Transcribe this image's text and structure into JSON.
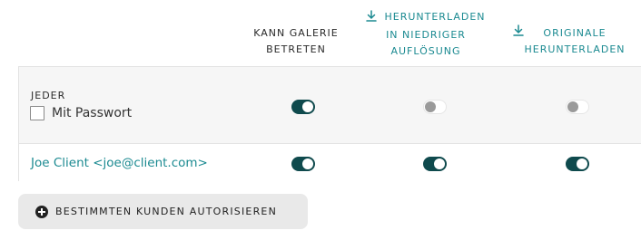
{
  "columns": {
    "enter_gallery": {
      "line1": "KANN GALERIE",
      "line2": "BETRETEN"
    },
    "download_low": {
      "line1": "HERUNTERLADEN",
      "line2": "IN NIEDRIGER",
      "line3": "AUFLÖSUNG",
      "icon": "download-icon"
    },
    "download_original": {
      "line1": "ORIGINALE",
      "line2": "HERUNTERLADEN",
      "icon": "download-icon"
    }
  },
  "rows": {
    "everyone": {
      "label": "JEDER",
      "password_label": "Mit Passwort",
      "password_checked": false,
      "enter_gallery": true,
      "download_low": false,
      "download_original": false
    },
    "client": {
      "label": "Joe Client <joe@client.com>",
      "enter_gallery": true,
      "download_low": true,
      "download_original": true
    }
  },
  "authorize_button": {
    "label": "BESTIMMTEN KUNDEN AUTORISIEREN",
    "icon": "plus-circle-icon"
  },
  "colors": {
    "accent": "#1b8a91",
    "toggle_on": "#0f4a4d",
    "row_bg": "#f6f6f6"
  }
}
